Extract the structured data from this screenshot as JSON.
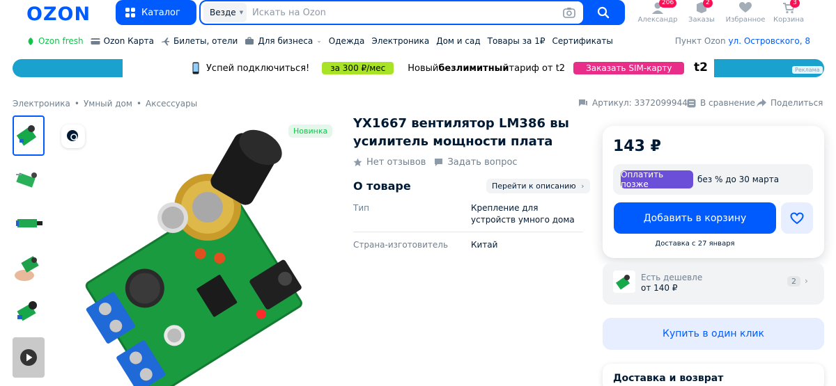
{
  "header": {
    "logo": "OZON",
    "catalog_label": "Каталог",
    "search_scope": "Везде",
    "search_placeholder": "Искать на Ozon",
    "items": [
      {
        "label": "Александр",
        "badge": "206"
      },
      {
        "label": "Заказы",
        "badge": "2"
      },
      {
        "label": "Избранное",
        "badge": ""
      },
      {
        "label": "Корзина",
        "badge": "3"
      }
    ]
  },
  "nav": {
    "items": [
      "Ozon fresh",
      "Ozon Карта",
      "Билеты, отели",
      "Для бизнеса",
      "Одежда",
      "Электроника",
      "Дом и сад",
      "Товары за 1₽",
      "Сертификаты"
    ],
    "pickup_label": "Пункт Ozon",
    "pickup_address": "ул. Островского, 8"
  },
  "banner": {
    "text1": "Успей подключиться!",
    "pill1": "за 300 ₽/мес",
    "text2_a": "Новый ",
    "text2_b": "безлимитный",
    "text2_c": " тариф от t2",
    "pill2": "Заказать SIM-карту",
    "brand": "t2",
    "ad_label": "Реклама"
  },
  "breadcrumbs": [
    "Электроника",
    "Умный дом",
    "Аксессуары"
  ],
  "meta": {
    "sku": "Артикул: 3372099944",
    "compare": "В сравнение",
    "share": "Поделиться"
  },
  "product": {
    "badge": "Новинка",
    "title": "YX1667 вентилятор LM386 вы усилитель мощности плата",
    "reviews": "Нет отзывов",
    "ask": "Задать вопрос",
    "about_title": "О товаре",
    "to_description": "Перейти к описанию",
    "props": [
      {
        "label": "Тип",
        "value": "Крепление для устройств умного дома"
      },
      {
        "label": "Страна-изготовитель",
        "value": "Китай"
      }
    ]
  },
  "buy": {
    "price": "143 ₽",
    "pay_later_btn": "Оплатить позже",
    "pay_later_text": "без % до 30 марта",
    "add_to_cart": "Добавить в корзину",
    "delivery": "Доставка с 27 января",
    "cheaper_title": "Есть дешевле",
    "cheaper_price": "от 140 ₽",
    "cheaper_count": "2",
    "one_click": "Купить в один клик",
    "returns_title": "Доставка и возврат"
  },
  "colors": {
    "brand_blue": "#005bff",
    "badge_pink": "#f91155",
    "fresh_green": "#10c44c",
    "pay_later_purple": "#6c4fd9"
  }
}
